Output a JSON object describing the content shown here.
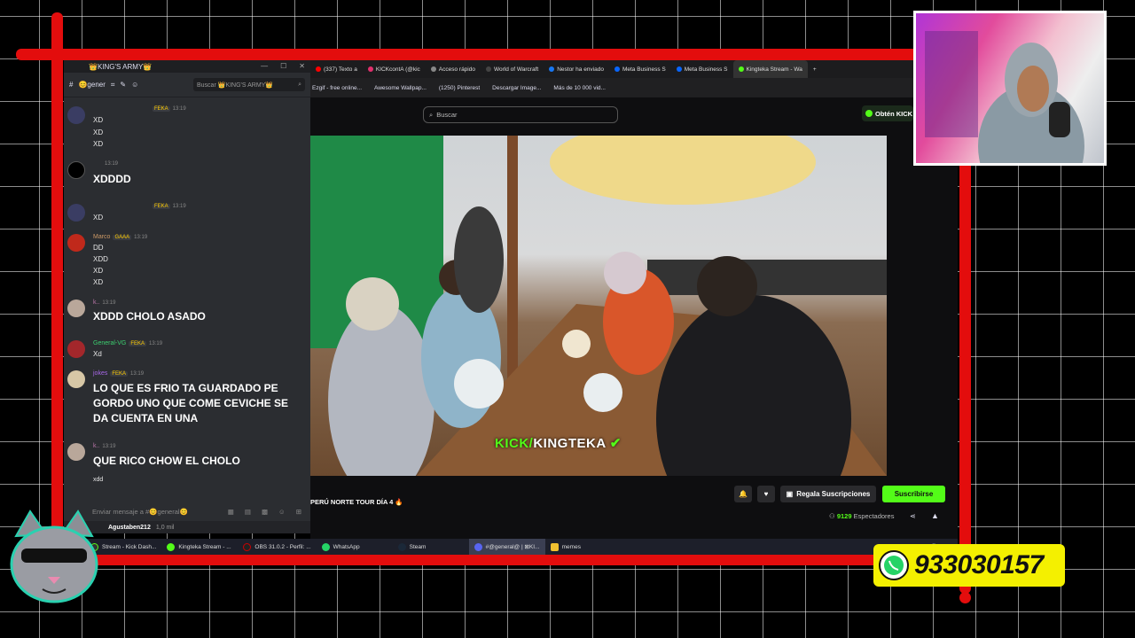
{
  "discord": {
    "server_title": "👑KING'S ARMY👑",
    "channel": "😊gener",
    "search_placeholder": "Buscar 👑KING'S ARMY👑",
    "messages": [
      {
        "user": "",
        "badge": "FEKA",
        "time": "13:19",
        "lines": [
          "XD",
          "XD",
          "XD"
        ]
      },
      {
        "user": "",
        "badge": "",
        "time": "13:19",
        "big": "XDDDD"
      },
      {
        "user": "",
        "badge": "FEKA",
        "time": "13:19",
        "lines": [
          "XD"
        ]
      },
      {
        "user": "Marco",
        "badge": "GAAA",
        "time": "13:19",
        "lines": [
          "DD",
          "XDD",
          "XD",
          "XD"
        ]
      },
      {
        "user": "k..",
        "badge": "",
        "time": "13:19",
        "big": "XDDD CHOLO ASADO"
      },
      {
        "user": "General-VG",
        "badge": "FEKA",
        "time": "13:19",
        "lines": [
          "Xd"
        ]
      },
      {
        "user": "jokes",
        "badge": "FEKA",
        "time": "13:19",
        "big": "LO QUE ES FRIO TA GUARDADO PE GORDO UNO QUE COME CEVICHE SE DA CUENTA EN UNA"
      },
      {
        "user": "k..",
        "badge": "",
        "time": "13:19",
        "big": "QUE RICO CHOW EL CHOLO",
        "lines": [
          "xdd"
        ]
      }
    ],
    "input_placeholder": "Enviar mensaje a #😊general😊",
    "footer_user": "Agustaben212",
    "footer_status": "1,0 mil"
  },
  "browser": {
    "tabs": [
      "(337) Texto a",
      "KICKcontA (@kic",
      "Acceso rápido",
      "World of Warcraft",
      "Nestor ha enviado",
      "Meta Business S",
      "Meta Business S",
      "Kingteka Stream - Wa"
    ],
    "bookmarks": [
      "Ezgif - free online...",
      "Awesome Wallpap...",
      "(1250) Pinterest",
      "Descargar Image...",
      "Más de 10 000 vid..."
    ],
    "search_placeholder": "Buscar",
    "obtain_label": "Obtén KICK"
  },
  "stream": {
    "overlay_prefix": "KICK/",
    "overlay_name": "KINGTEKA",
    "title": "PERÚ NORTE TOUR DÍA 4 🔥",
    "gift_label": "Regala Suscripciones",
    "subscribe_label": "Suscribirse",
    "viewers_count": "9129",
    "viewers_label": "Espectadores"
  },
  "taskbar": {
    "items": [
      "Stream - Kick Dash...",
      "Kingteka Stream - ...",
      "OBS 31.0.2 - Perfil: ...",
      "WhatsApp",
      "Steam",
      "#@general@ | ⊠KI...",
      "memes"
    ]
  },
  "overlay": {
    "phone": "933030157"
  },
  "colors": {
    "kick_green": "#53fc18",
    "frame_red": "#e30d0d",
    "whatsapp_yellow": "#f4f000"
  }
}
